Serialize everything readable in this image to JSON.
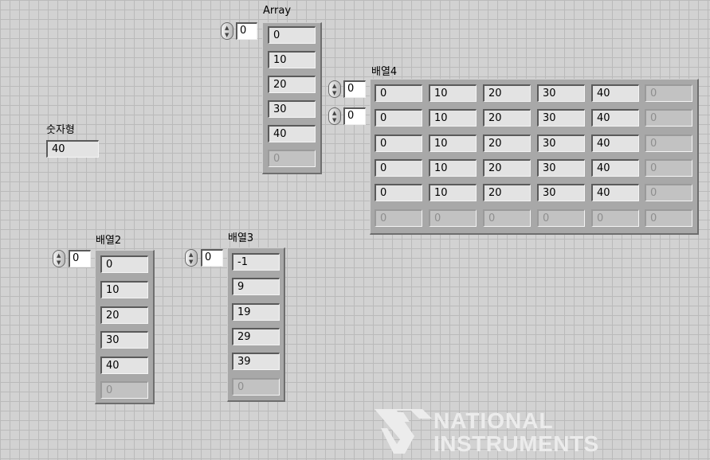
{
  "numeric": {
    "label": "숫자형",
    "value": "40"
  },
  "array1": {
    "label": "Array",
    "index": "0",
    "values": [
      "0",
      "10",
      "20",
      "30",
      "40"
    ],
    "empty": "0"
  },
  "array2": {
    "label": "배열2",
    "index": "0",
    "values": [
      "0",
      "10",
      "20",
      "30",
      "40"
    ],
    "empty": "0"
  },
  "array3": {
    "label": "배열3",
    "index": "0",
    "values": [
      "-1",
      "9",
      "19",
      "29",
      "39"
    ],
    "empty": "0"
  },
  "array4": {
    "label": "배열4",
    "row_index": "0",
    "col_index": "0",
    "rows": [
      [
        "0",
        "10",
        "20",
        "30",
        "40",
        "0"
      ],
      [
        "0",
        "10",
        "20",
        "30",
        "40",
        "0"
      ],
      [
        "0",
        "10",
        "20",
        "30",
        "40",
        "0"
      ],
      [
        "0",
        "10",
        "20",
        "30",
        "40",
        "0"
      ],
      [
        "0",
        "10",
        "20",
        "30",
        "40",
        "0"
      ],
      [
        "0",
        "0",
        "0",
        "0",
        "0",
        "0"
      ]
    ]
  },
  "logo": {
    "line1": "NATIONAL",
    "line2": "INSTRUMENTS"
  }
}
